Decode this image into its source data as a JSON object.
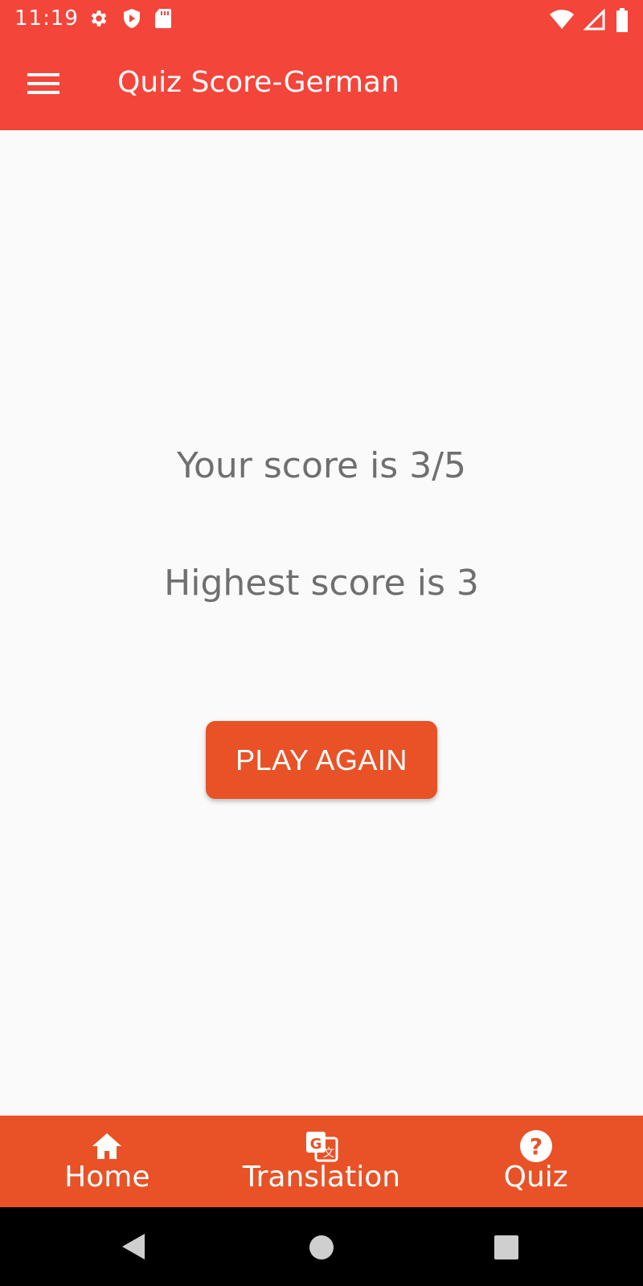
{
  "status_bar": {
    "time": "11:19",
    "left_icons": [
      "gear-icon",
      "shield-icon",
      "sd-card-icon"
    ],
    "right_icons": [
      "wifi-icon",
      "signal-icon",
      "battery-icon"
    ]
  },
  "app_bar": {
    "title": "Quiz Score-German",
    "menu_icon": "menu-icon"
  },
  "score": {
    "your_score_text": "Your score is 3/5",
    "highest_score_text": "Highest score is 3"
  },
  "play_again": {
    "label": "PLAY AGAIN"
  },
  "bottom_nav": {
    "items": [
      {
        "label": "Home",
        "icon": "home-icon"
      },
      {
        "label": "Translation",
        "icon": "translate-icon"
      },
      {
        "label": "Quiz",
        "icon": "help-circle-icon"
      }
    ]
  },
  "colors": {
    "app_bar": "#f4453a",
    "accent": "#e85226",
    "text_secondary": "#6f6f6f",
    "background": "#fafafa"
  }
}
